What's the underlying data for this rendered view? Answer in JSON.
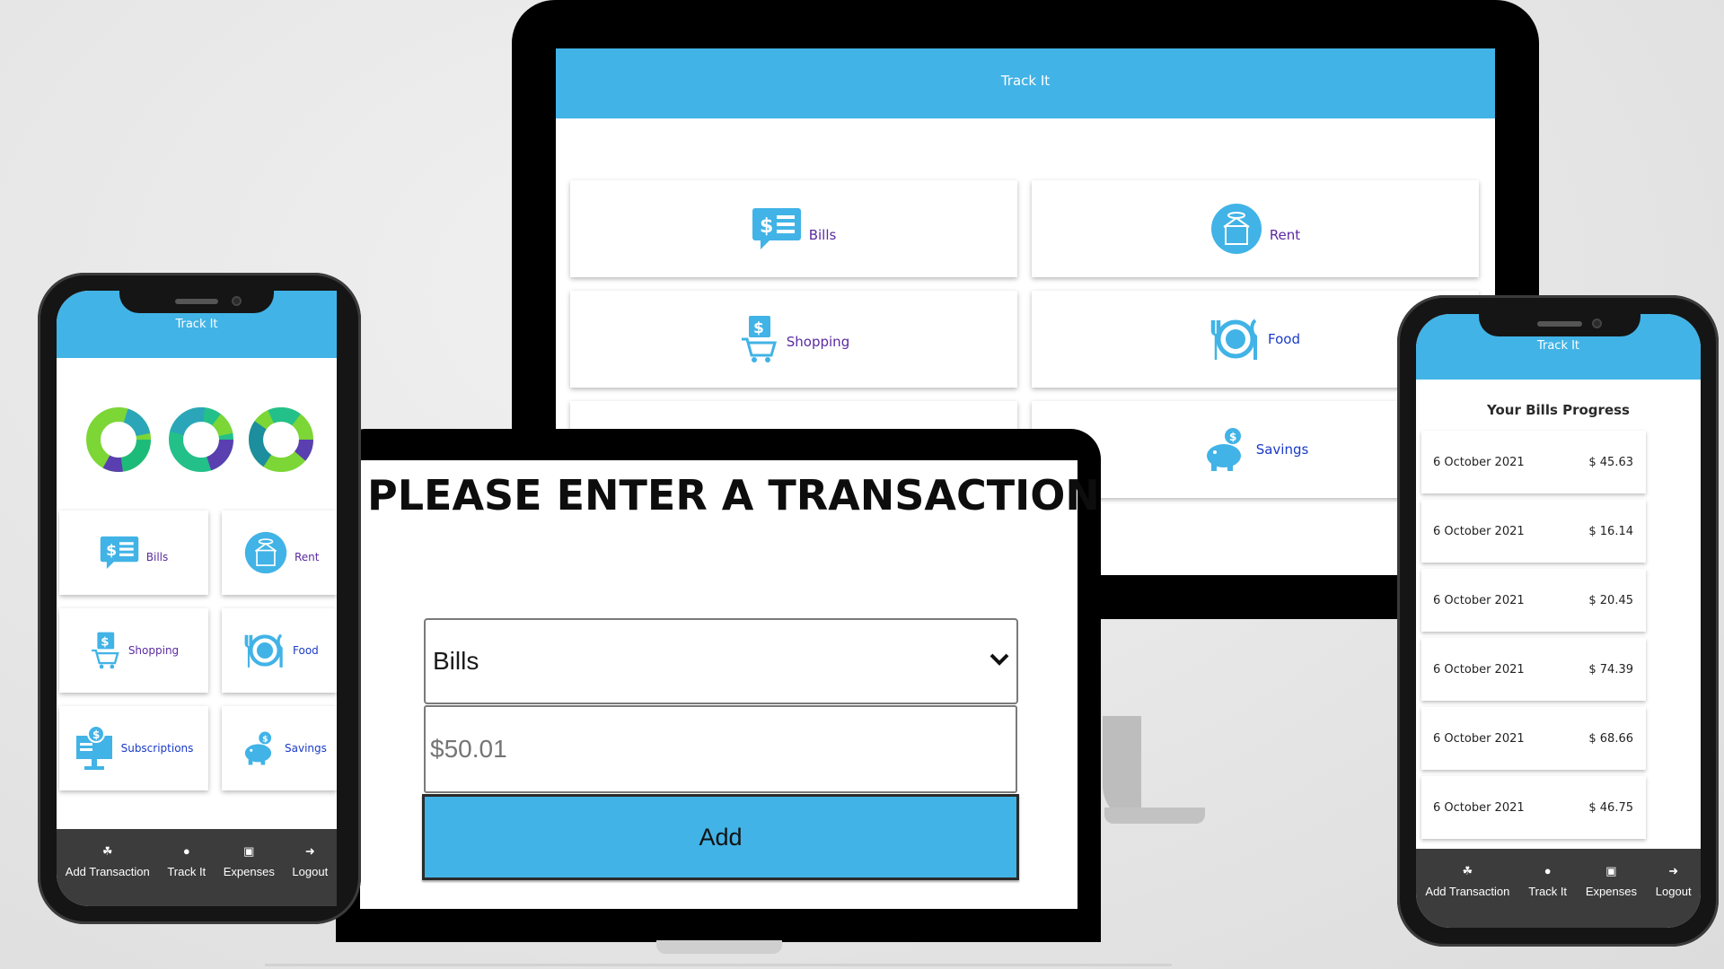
{
  "app": {
    "title": "Track It"
  },
  "categories": {
    "bills": "Bills",
    "rent": "Rent",
    "shopping": "Shopping",
    "food": "Food",
    "subscriptions": "Subscriptions",
    "savings": "Savings"
  },
  "tabs": {
    "add_transaction": "Add Transaction",
    "track_it": "Track It",
    "expenses": "Expenses",
    "logout": "Logout"
  },
  "tablet": {
    "heading": "PLEASE ENTER A TRANSACTION",
    "category_selected": "Bills",
    "amount_placeholder": "$50.01",
    "add_button": "Add"
  },
  "bills_progress": {
    "title": "Your Bills Progress",
    "rows": [
      {
        "date": "6 October 2021",
        "amount": "$ 45.63"
      },
      {
        "date": "6 October 2021",
        "amount": "$ 16.14"
      },
      {
        "date": "6 October 2021",
        "amount": "$ 20.45"
      },
      {
        "date": "6 October 2021",
        "amount": "$ 74.39"
      },
      {
        "date": "6 October 2021",
        "amount": "$ 68.66"
      },
      {
        "date": "6 October 2021",
        "amount": "$ 46.75"
      }
    ]
  },
  "colors": {
    "accent": "#41b3e6",
    "tabbar": "#3c3c3c",
    "label_purple": "#5b2aa0",
    "label_blue": "#1a3ac7"
  },
  "icons": [
    "bills-icon",
    "rent-icon",
    "shopping-icon",
    "food-icon",
    "subscriptions-icon",
    "savings-icon",
    "hand-coin-icon",
    "piggy-icon",
    "money-icon",
    "logout-icon",
    "chevron-down-icon"
  ]
}
